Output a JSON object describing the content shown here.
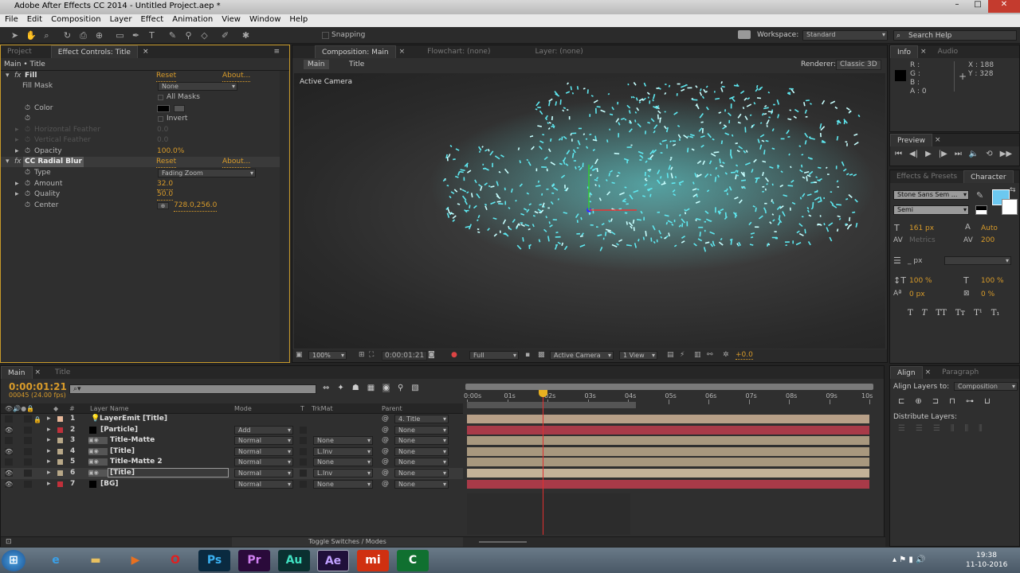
{
  "window": {
    "title": "Adobe After Effects CC 2014 - Untitled Project.aep *"
  },
  "menu": [
    "File",
    "Edit",
    "Composition",
    "Layer",
    "Effect",
    "Animation",
    "View",
    "Window",
    "Help"
  ],
  "toolbar": {
    "snapping": "Snapping",
    "workspace_label": "Workspace:",
    "workspace": "Standard",
    "search_placeholder": "Search Help"
  },
  "effect_controls": {
    "tabs": {
      "project": "Project",
      "effect": "Effect Controls: Title"
    },
    "breadcrumb": "Main • Title",
    "reset": "Reset",
    "about": "About...",
    "fill": {
      "name": "Fill",
      "fill_mask_label": "Fill Mask",
      "fill_mask": "None",
      "all_masks": "All Masks",
      "color": "Color",
      "invert": "Invert",
      "h_feather": "Horizontal Feather",
      "h_feather_val": "0.0",
      "v_feather": "Vertical Feather",
      "v_feather_val": "0.0",
      "opacity": "Opacity",
      "opacity_val": "100.0%",
      "color_value": "#000000"
    },
    "radial": {
      "name": "CC Radial Blur",
      "type_label": "Type",
      "type": "Fading Zoom",
      "amount": "Amount",
      "amount_val": "32.0",
      "quality": "Quality",
      "quality_val": "50.0",
      "center": "Center",
      "center_val": "728.0,256.0"
    }
  },
  "comp": {
    "tabs": {
      "comp": "Composition: Main",
      "flowchart": "Flowchart: (none)",
      "layer": "Layer: (none)"
    },
    "crumbs": [
      "Main",
      "Title"
    ],
    "renderer_label": "Renderer:",
    "renderer": "Classic 3D",
    "camera_label": "Active Camera",
    "footer": {
      "zoom": "100%",
      "time": "0:00:01:21",
      "resolution": "Full",
      "camera": "Active Camera",
      "views": "1 View",
      "exposure": "+0.0"
    }
  },
  "info": {
    "tabs": [
      "Info",
      "Audio"
    ],
    "r": "R :",
    "g": "G :",
    "b": "B :",
    "a": "A : 0",
    "x": "X : 188",
    "y": "Y : 328"
  },
  "preview": {
    "tab": "Preview"
  },
  "character": {
    "tabs": [
      "Effects & Presets",
      "Character"
    ],
    "font": "Stone Sans Sem ...",
    "style": "Semi",
    "size": "161 px",
    "leading": "Auto",
    "kerning": "Metrics",
    "tracking": "200",
    "stroke": "_ px",
    "vscale": "100 %",
    "hscale": "100 %",
    "baseline": "0 px",
    "tsume": "0 %",
    "fill_color": "#6cc8f0"
  },
  "align": {
    "tabs": [
      "Align",
      "Paragraph"
    ],
    "align_to_label": "Align Layers to:",
    "align_to": "Composition",
    "distribute": "Distribute Layers:"
  },
  "timeline": {
    "tabs": [
      "Main",
      "Title"
    ],
    "timecode": "0:00:01:21",
    "frames": "00045 (24.00 fps)",
    "columns": {
      "num": "#",
      "name": "Layer Name",
      "mode": "Mode",
      "t": "T",
      "trkmat": "TrkMat",
      "parent": "Parent"
    },
    "ruler": [
      "0:00s",
      "01s",
      "02s",
      "03s",
      "04s",
      "05s",
      "06s",
      "07s",
      "08s",
      "09s",
      "10s"
    ],
    "current_time_s": 1.875,
    "work_area_end_s": 4.2,
    "duration_s": 10,
    "toggle": "Toggle Switches / Modes",
    "layers": [
      {
        "n": "1",
        "name": "LayerEmit [Title]",
        "mode": "",
        "trkmat": "",
        "parent": "4. Title",
        "color": "#e8b89a",
        "bar": "#b8a088",
        "visible": false
      },
      {
        "n": "2",
        "name": "[Particle]",
        "mode": "Add",
        "trkmat": "",
        "parent": "None",
        "color": "#c0303a",
        "bar": "#a83a48",
        "visible": true
      },
      {
        "n": "3",
        "name": "Title-Matte",
        "mode": "Normal",
        "trkmat": "None",
        "parent": "None",
        "color": "#b8a888",
        "bar": "#a8987e",
        "visible": false
      },
      {
        "n": "4",
        "name": "[Title]",
        "mode": "Normal",
        "trkmat": "L.Inv",
        "parent": "None",
        "color": "#b8a888",
        "bar": "#a8987e",
        "visible": true
      },
      {
        "n": "5",
        "name": "Title-Matte 2",
        "mode": "Normal",
        "trkmat": "None",
        "parent": "None",
        "color": "#b8a888",
        "bar": "#a8987e",
        "visible": false
      },
      {
        "n": "6",
        "name": "[Title]",
        "mode": "Normal",
        "trkmat": "L.Inv",
        "parent": "None",
        "color": "#b8a888",
        "bar": "#c4b298",
        "visible": true
      },
      {
        "n": "7",
        "name": "[BG]",
        "mode": "Normal",
        "trkmat": "None",
        "parent": "None",
        "color": "#c0303a",
        "bar": "#a83a48",
        "visible": true
      }
    ]
  },
  "taskbar": {
    "apps": [
      "Ps",
      "Pr",
      "Au",
      "Ae"
    ],
    "time": "19:38",
    "date": "11-10-2016"
  }
}
